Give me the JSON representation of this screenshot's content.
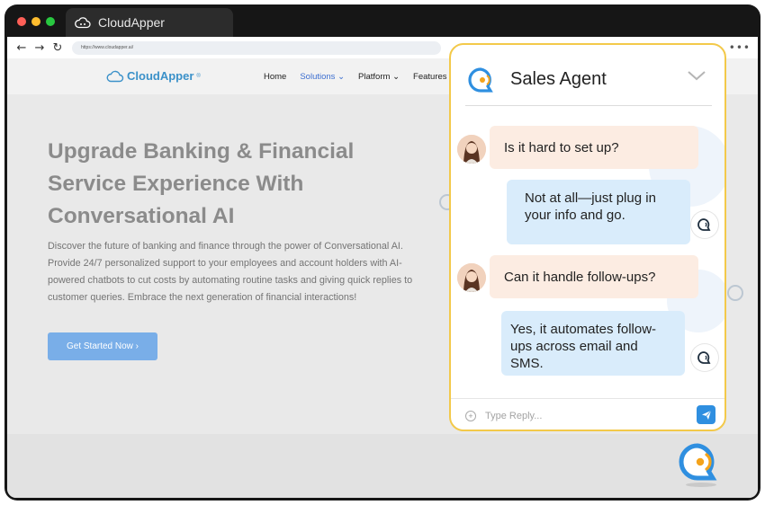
{
  "browser": {
    "tab_title": "CloudApper",
    "url": "https://www.cloudapper.ai/",
    "dot_colors": [
      "#ff5f57",
      "#febc2e",
      "#28c840"
    ]
  },
  "site": {
    "logo_text": "CloudApper",
    "logo_mark": "®",
    "nav": [
      "Home",
      "Solutions",
      "Platform",
      "Features"
    ],
    "hero_title": "Upgrade Banking & Financial Service Experience With Conversational AI",
    "hero_text": "Discover the future of banking and finance through the power of Conversational AI. Provide 24/7 personalized support to your employees and account holders with AI-powered chatbots to cut costs by automating routine tasks and giving quick replies to customer queries. Embrace the next generation of financial interactions!",
    "cta_label": "Get Started Now ›"
  },
  "chat": {
    "title": "Sales Agent",
    "messages": [
      {
        "from": "user",
        "text": "Is it hard to set up?"
      },
      {
        "from": "bot",
        "text": "Not at all—just plug in your info and go."
      },
      {
        "from": "user",
        "text": "Can it handle follow-ups?"
      },
      {
        "from": "bot",
        "text": "Yes, it automates follow-ups across email and SMS."
      }
    ],
    "reply_placeholder": "Type Reply..."
  },
  "colors": {
    "accent_yellow": "#f3c94a",
    "brand_blue": "#2f8fe0",
    "brand_orange": "#f4a31b",
    "cta_blue": "#79aee8"
  }
}
